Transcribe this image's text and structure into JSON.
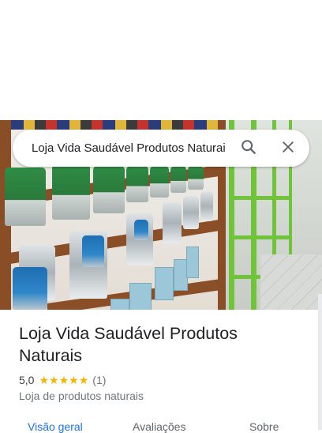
{
  "search": {
    "query": "Loja Vida Saudável Produtos Naturais"
  },
  "icons": {
    "search": "search-icon",
    "close": "close-icon",
    "star": "star-icon"
  },
  "place": {
    "title": "Loja Vida Saudável Produtos Naturais",
    "rating": "5,0",
    "star_count": 5,
    "review_count": "(1)",
    "category": "Loja de produtos naturais"
  },
  "tabs": [
    {
      "label": "Visão geral",
      "active": true
    },
    {
      "label": "Avaliações",
      "active": false
    },
    {
      "label": "Sobre",
      "active": false
    }
  ],
  "colors": {
    "accent": "#1a73e8",
    "star": "#f4b400",
    "text_primary": "#202124",
    "text_secondary": "#70757a"
  }
}
